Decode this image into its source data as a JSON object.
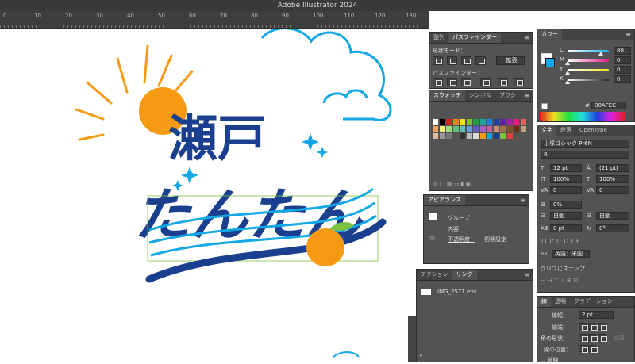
{
  "window": {
    "title": "Adobe Illustrator 2024"
  },
  "ruler": {
    "ticks": [
      "0",
      "10",
      "20",
      "30",
      "40",
      "50",
      "60",
      "70",
      "80",
      "90",
      "100",
      "110",
      "120",
      "130"
    ]
  },
  "artwork": {
    "line1": "瀬戸",
    "line2": "たんたん",
    "colors": {
      "navy": "#1b3f8f",
      "sky": "#12a7e6",
      "orange": "#f59a12",
      "green": "#7ec242"
    }
  },
  "pathfinder_panel": {
    "tabs": [
      "整列",
      "パスファインダー"
    ],
    "shape_mode_label": "形状モード：",
    "expand_label": "拡張",
    "pathfinder_label": "パスファインダー："
  },
  "swatches_panel": {
    "tabs": [
      "スウォッチ",
      "シンボル",
      "ブラシ"
    ]
  },
  "color_panel": {
    "tab": "カラー",
    "channels": [
      {
        "name": "C",
        "value": "80",
        "fraction": 0.8,
        "color": "#1ab0e8"
      },
      {
        "name": "M",
        "value": "0",
        "fraction": 0,
        "color": "#e0208a"
      },
      {
        "name": "Y",
        "value": "0",
        "fraction": 0,
        "color": "#f2e21a"
      },
      {
        "name": "K",
        "value": "0",
        "fraction": 0,
        "color": "#222222"
      }
    ],
    "hex": "00AFEC"
  },
  "character_panel": {
    "tabs": [
      "文字",
      "段落",
      "OpenType"
    ],
    "font": "小塚ゴシック Pr6N",
    "style": "R",
    "size": "12 pt",
    "leading": "(21 pt)",
    "vscale": "100%",
    "hscale": "100%",
    "kerning": "0",
    "tracking": "0",
    "tsume": "0%",
    "aki_left": "自動",
    "aki_right": "自動",
    "baseline": "0 pt",
    "rotation": "0°",
    "language": "英語：米国",
    "snap_label": "グリフにスナップ"
  },
  "appearance_panel": {
    "tab": "アピアランス",
    "group_label": "グループ",
    "content_label": "内容",
    "opacity_label": "不透明度：",
    "opacity_value": "初期設定"
  },
  "links_panel": {
    "tabs": [
      "アクション",
      "リンク"
    ],
    "file": "IMG_2571.eps"
  },
  "stroke_panel": {
    "tabs": [
      "線",
      "透明",
      "グラデーション"
    ],
    "weight_label": "線幅：",
    "weight_value": "2 pt",
    "cap_label": "線端：",
    "corner_label": "角の形状：",
    "limit_label": "比率",
    "align_label": "線の位置：",
    "dash_label": "破線"
  }
}
